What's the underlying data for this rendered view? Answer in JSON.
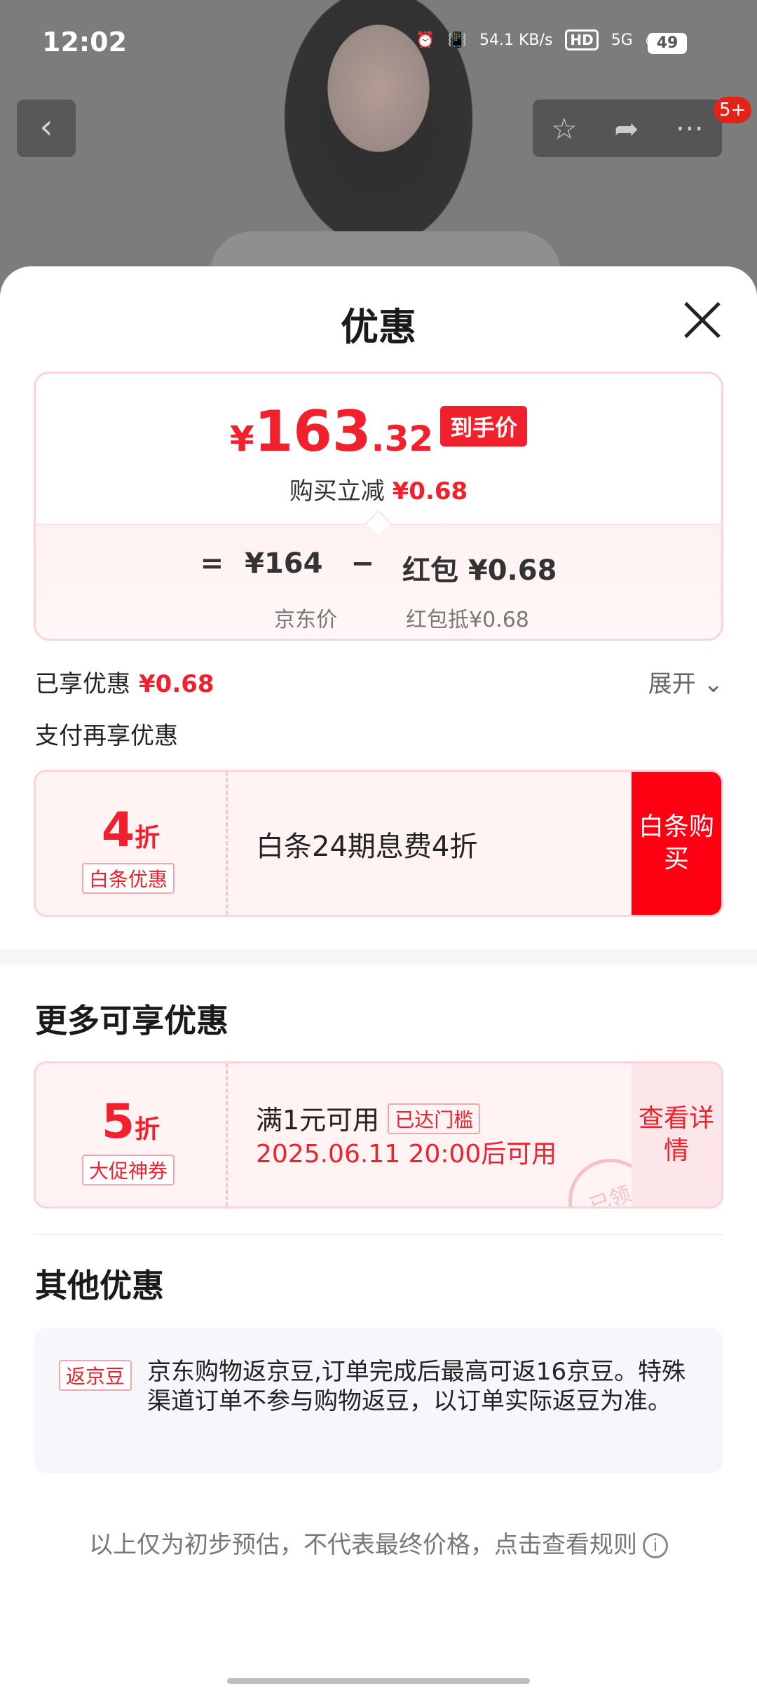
{
  "status_bar": {
    "time": "12:02",
    "net_speed": "54.1 KB/s",
    "hd": "HD",
    "signal": "5G",
    "battery": "49"
  },
  "top_nav": {
    "back_icon": "chevron-left-icon",
    "badge": "5+"
  },
  "sheet": {
    "title": "优惠",
    "final_price": {
      "currency": "¥",
      "integer": "163",
      "decimal": ".32",
      "tag": "到手价",
      "instant_reduce_label": "购买立减",
      "instant_reduce_value": "¥0.68"
    },
    "formula": {
      "eq": "=",
      "base_price": "¥164",
      "minus": "−",
      "deduct": "红包 ¥0.68",
      "base_label": "京东价",
      "deduct_label": "红包抵¥0.68"
    },
    "enjoyed_label": "已享优惠",
    "enjoyed_value": "¥0.68",
    "expand_label": "展开",
    "pay_more_label": "支付再享优惠",
    "baitiao_coupon": {
      "discount_num": "4",
      "discount_unit": "折",
      "type": "白条优惠",
      "description": "白条24期息费4折",
      "action": "白条购买"
    },
    "more_title": "更多可享优惠",
    "promo_coupon": {
      "discount_num": "5",
      "discount_unit": "折",
      "type": "大促神券",
      "condition": "满1元可用",
      "threshold_tag": "已达门槛",
      "valid_time": "2025.06.11 20:00后可用",
      "action": "查看详情",
      "stamp": "已领"
    },
    "other_title": "其他优惠",
    "jingdou": {
      "tag": "返京豆",
      "text": "京东购物返京豆,订单完成后最高可返16京豆。特殊渠道订单不参与购物返豆，以订单实际返豆为准。"
    },
    "footnote": "以上仅为初步预估，不代表最终价格，点击查看规则",
    "info_icon": "i"
  },
  "colors": {
    "accent_red": "#f0202c",
    "button_red": "#ff0012"
  }
}
